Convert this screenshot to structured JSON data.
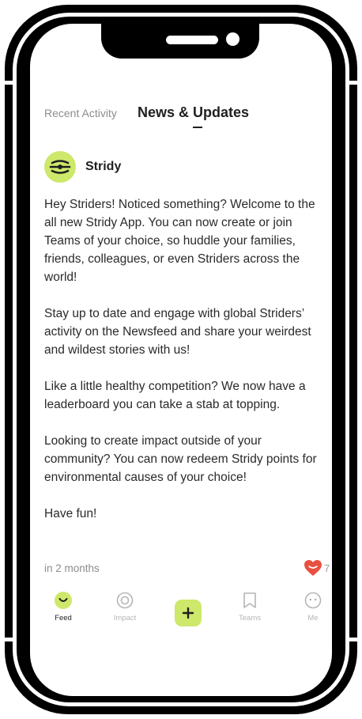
{
  "tabs": [
    {
      "label": "Recent Activity",
      "active": false
    },
    {
      "label": "News & Updates",
      "active": true
    }
  ],
  "post": {
    "author": "Stridy",
    "paragraphs": [
      "Hey Striders! Noticed something? Welcome to the all new Stridy App. You can now create or join Teams of your choice, so huddle your families, friends, colleagues, or even Striders across the world!",
      "Stay up to date and engage with global Striders’ activity on the Newsfeed and share your weirdest and wildest stories with us!",
      "Like a little healthy competition? We now have a leaderboard you can take a stab at topping.",
      "Looking to create impact outside of your community? You can now redeem Stridy points for environmental causes of your choice!",
      "Have fun!"
    ],
    "timestamp": "in 2 months",
    "likes": "7"
  },
  "nav": {
    "feed": "Feed",
    "impact": "Impact",
    "teams": "Teams",
    "me": "Me"
  },
  "colors": {
    "accent": "#cde86a",
    "heart": "#e8503f",
    "text": "#1f1f1f",
    "muted": "#8c8c8c"
  }
}
